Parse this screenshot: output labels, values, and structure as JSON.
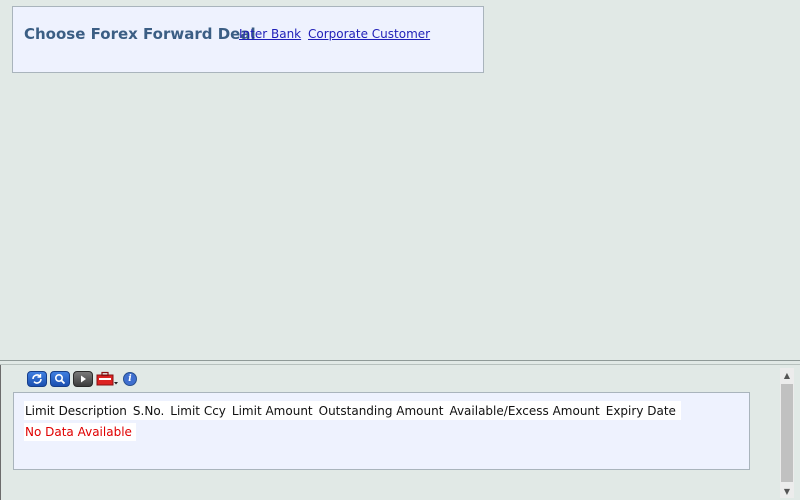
{
  "deal_panel": {
    "title": "Choose Forex Forward Deal",
    "links": [
      "Inter Bank",
      "Corporate Customer"
    ]
  },
  "toolbar": {
    "icons": [
      "refresh-icon",
      "search-icon",
      "next-icon",
      "toolbox-icon",
      "info-icon"
    ]
  },
  "grid": {
    "columns": [
      "Limit Description",
      "S.No.",
      "Limit Ccy",
      "Limit Amount",
      "Outstanding Amount",
      "Available/Excess Amount",
      "Expiry Date"
    ],
    "empty_message": "No Data Available"
  },
  "colors": {
    "background": "#e1e9e6",
    "panel": "#eef2fe",
    "title": "#3b5e84",
    "link": "#1f1fb8",
    "empty_message": "#e00000"
  }
}
